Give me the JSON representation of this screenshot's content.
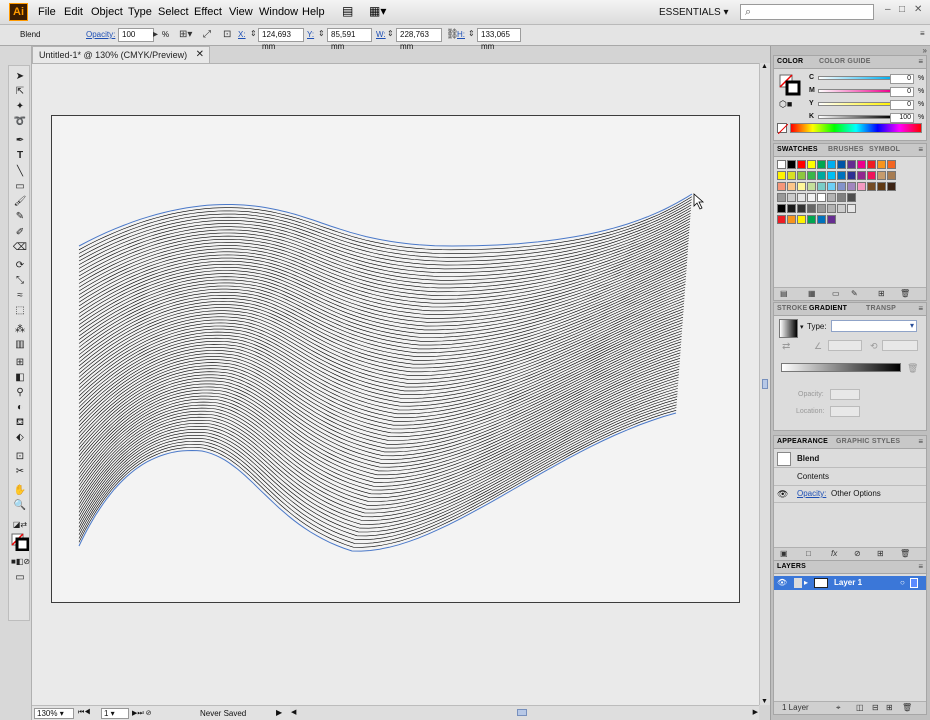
{
  "app": {
    "logo": "Ai",
    "menu": [
      "File",
      "Edit",
      "Object",
      "Type",
      "Select",
      "Effect",
      "View",
      "Window",
      "Help"
    ],
    "workspace": "ESSENTIALS",
    "window_controls": [
      "–",
      "□",
      "✕"
    ]
  },
  "controlbar": {
    "object_type": "Blend",
    "opacity_label": "Opacity:",
    "opacity_value": "100",
    "opacity_unit": "%",
    "x_label": "X:",
    "x_value": "124,693 mm",
    "y_label": "Y:",
    "y_value": "85,591 mm",
    "w_label": "W:",
    "w_value": "228,763 mm",
    "h_label": "H:",
    "h_value": "133,065 mm"
  },
  "document": {
    "tab_title": "Untitled-1* @ 130% (CMYK/Preview)",
    "close": "✕"
  },
  "statusbar": {
    "zoom": "130%",
    "artboard": "1",
    "status_text": "Never Saved"
  },
  "color_panel": {
    "tabs": [
      "COLOR",
      "COLOR GUIDE"
    ],
    "channels": [
      {
        "label": "C",
        "value": "0",
        "unit": "%",
        "gradient": "linear-gradient(90deg,#fff,#00aeef)"
      },
      {
        "label": "M",
        "value": "0",
        "unit": "%",
        "gradient": "linear-gradient(90deg,#fff,#ec008c)"
      },
      {
        "label": "Y",
        "value": "0",
        "unit": "%",
        "gradient": "linear-gradient(90deg,#fff,#fff200)"
      },
      {
        "label": "K",
        "value": "100",
        "unit": "%",
        "gradient": "linear-gradient(90deg,#fff,#000)"
      }
    ]
  },
  "swatches_panel": {
    "tabs": [
      "SWATCHES",
      "BRUSHES",
      "SYMBOL"
    ],
    "rows": [
      [
        "#ffffff",
        "#000000",
        "#ff0000",
        "#ffff00",
        "#00a651",
        "#00aeef",
        "#0054a6",
        "#662d91",
        "#ec008c",
        "#ed1c24",
        "#f7941d",
        "#f26522"
      ],
      [
        "#fff200",
        "#d7df23",
        "#8dc63f",
        "#39b54a",
        "#00a99d",
        "#00bff3",
        "#0072bc",
        "#2e3192",
        "#92278f",
        "#ee145b",
        "#c69c6d",
        "#a67c52"
      ],
      [
        "#f69679",
        "#fdc689",
        "#fff799",
        "#c4df9b",
        "#7accc8",
        "#6dcff6",
        "#8393ca",
        "#a186be",
        "#f49ac1",
        "#754c24",
        "#603913",
        "#3c2415"
      ],
      [
        "#999999",
        "#cccccc",
        "#e6e6e6",
        "#f2f2f2",
        "#ffffff",
        "#b3b3b3",
        "#808080",
        "#4d4d4d"
      ],
      [
        "#000000",
        "#1a1a1a",
        "#333333",
        "#666666",
        "#999999",
        "#b3b3b3",
        "#cccccc",
        "#e6e6e6"
      ],
      [
        "#ed1c24",
        "#f7941d",
        "#fff200",
        "#00a651",
        "#0072bc",
        "#662d91"
      ]
    ]
  },
  "gradient_panel": {
    "tabs": [
      "STROKE",
      "GRADIENT",
      "TRANSP"
    ],
    "type_label": "Type:",
    "opacity_label": "Opacity:",
    "location_label": "Location:"
  },
  "appearance_panel": {
    "tabs": [
      "APPEARANCE",
      "GRAPHIC STYLES"
    ],
    "object": "Blend",
    "contents": "Contents",
    "opacity_label": "Opacity:",
    "opacity_value": "Other Options"
  },
  "layers_panel": {
    "tab": "LAYERS",
    "layer_name": "Layer 1",
    "count": "1 Layer"
  },
  "blend": {
    "steps": 80,
    "stroke_color": "#000000",
    "path_color": "#4a78c8"
  }
}
